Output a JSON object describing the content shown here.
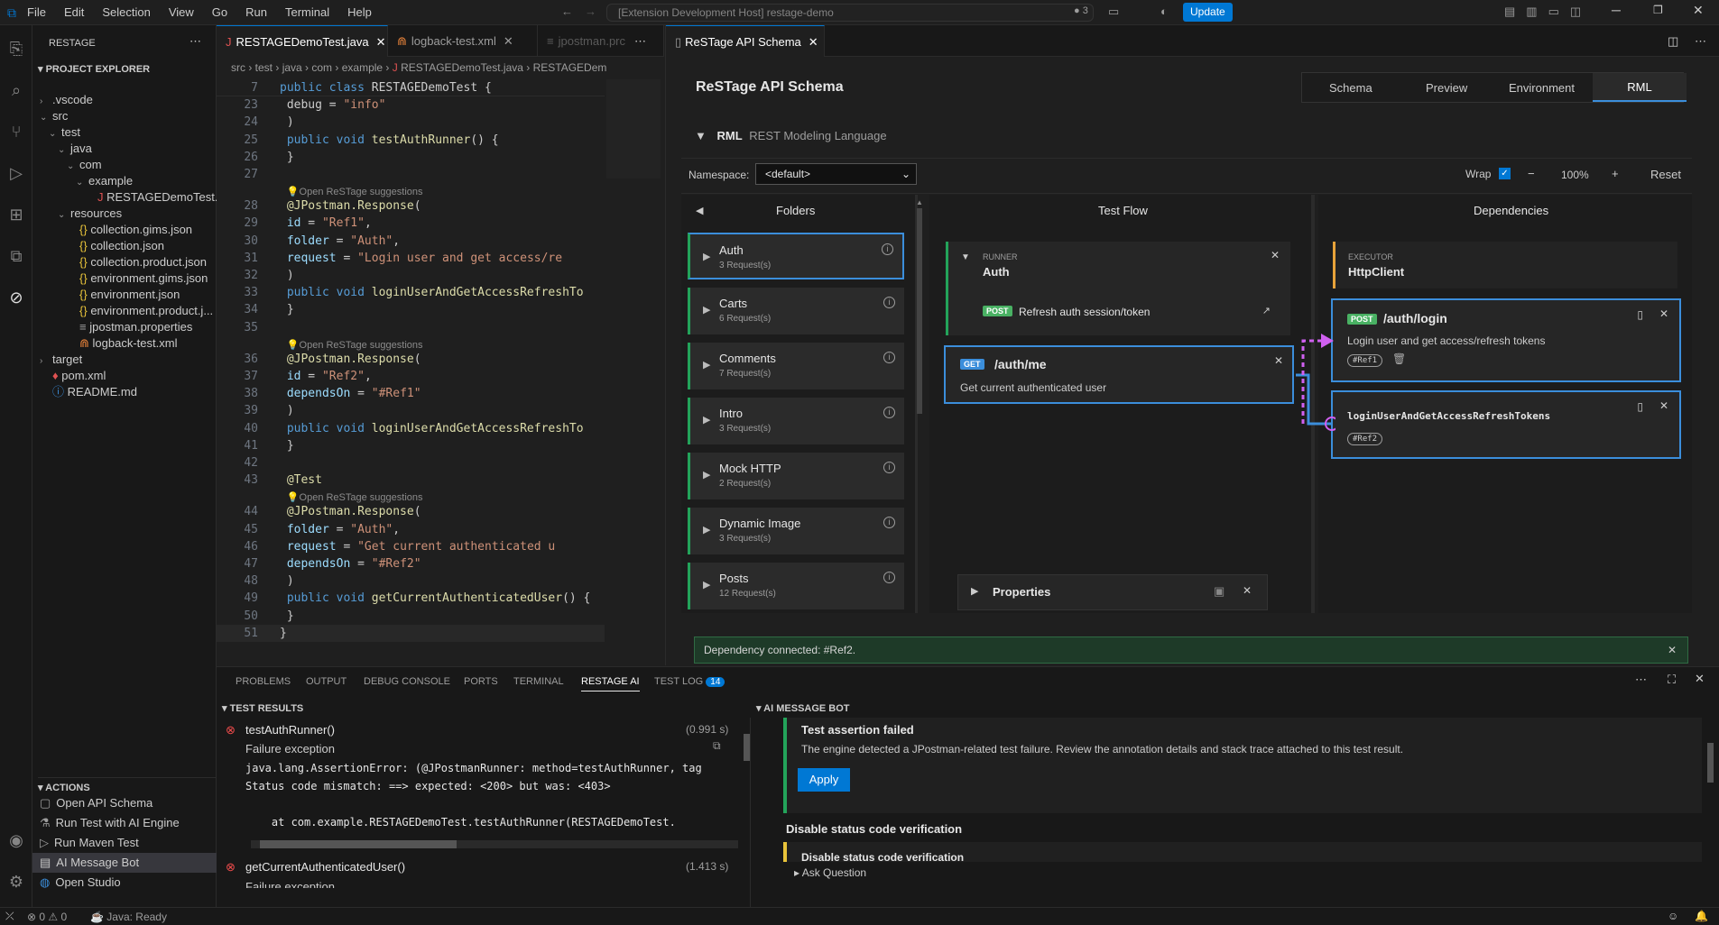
{
  "titlebar": {
    "menus": [
      "File",
      "Edit",
      "Selection",
      "View",
      "Go",
      "Run",
      "Terminal",
      "Help"
    ],
    "command_center": "[Extension Development Host] restage-demo",
    "notif_count": "3",
    "update_label": "Update"
  },
  "sidebar": {
    "title": "RESTAGE",
    "section": "PROJECT EXPLORER",
    "tree": [
      {
        "label": ".vscode",
        "depth": 0,
        "type": "folder",
        "open": false
      },
      {
        "label": "src",
        "depth": 0,
        "type": "folder",
        "open": true
      },
      {
        "label": "test",
        "depth": 1,
        "type": "folder",
        "open": true
      },
      {
        "label": "java",
        "depth": 2,
        "type": "folder",
        "open": true
      },
      {
        "label": "com",
        "depth": 3,
        "type": "folder",
        "open": true
      },
      {
        "label": "example",
        "depth": 4,
        "type": "folder",
        "open": true
      },
      {
        "label": "RESTAGEDemoTest....",
        "depth": 5,
        "type": "java"
      },
      {
        "label": "resources",
        "depth": 2,
        "type": "folder",
        "open": true
      },
      {
        "label": "collection.gims.json",
        "depth": 3,
        "type": "json"
      },
      {
        "label": "collection.json",
        "depth": 3,
        "type": "json"
      },
      {
        "label": "collection.product.json",
        "depth": 3,
        "type": "json"
      },
      {
        "label": "environment.gims.json",
        "depth": 3,
        "type": "json"
      },
      {
        "label": "environment.json",
        "depth": 3,
        "type": "json"
      },
      {
        "label": "environment.product.j...",
        "depth": 3,
        "type": "json"
      },
      {
        "label": "jpostman.properties",
        "depth": 3,
        "type": "props"
      },
      {
        "label": "logback-test.xml",
        "depth": 3,
        "type": "xml"
      },
      {
        "label": "target",
        "depth": 0,
        "type": "folder",
        "open": false
      },
      {
        "label": "pom.xml",
        "depth": 0,
        "type": "pom"
      },
      {
        "label": "README.md",
        "depth": 0,
        "type": "md"
      }
    ],
    "actions_title": "ACTIONS",
    "actions": [
      "Open API Schema",
      "Run Test with AI Engine",
      "Run Maven Test",
      "AI Message Bot",
      "Open Studio"
    ]
  },
  "editor": {
    "tabs": [
      "RESTAGEDemoTest.java",
      "logback-test.xml",
      "jpostman.prc"
    ],
    "breadcrumb": [
      "src",
      "test",
      "java",
      "com",
      "example",
      "RESTAGEDemoTest.java",
      "RESTAGEDem"
    ],
    "sticky": {
      "num": "7",
      "text": "public class RESTAGEDemoTest {"
    },
    "hint": "Open ReSTage suggestions"
  },
  "schema": {
    "tab_label": "ReSTage API Schema",
    "title": "ReSTage API Schema",
    "tabs": [
      "Schema",
      "Preview",
      "Environment",
      "RML"
    ],
    "rml_label": "RML",
    "rml_sub": "REST Modeling Language",
    "namespace_label": "Namespace:",
    "namespace_value": "<default>",
    "wrap_label": "Wrap",
    "zoom": "100%",
    "reset": "Reset",
    "minus": "−",
    "plus": "+",
    "folders_title": "Folders",
    "flow_title": "Test Flow",
    "deps_title": "Dependencies",
    "folders": [
      {
        "name": "Auth",
        "count": "3 Request(s)"
      },
      {
        "name": "Carts",
        "count": "6 Request(s)"
      },
      {
        "name": "Comments",
        "count": "7 Request(s)"
      },
      {
        "name": "Intro",
        "count": "3 Request(s)"
      },
      {
        "name": "Mock HTTP",
        "count": "2 Request(s)"
      },
      {
        "name": "Dynamic Image",
        "count": "3 Request(s)"
      },
      {
        "name": "Posts",
        "count": "12 Request(s)"
      }
    ],
    "runner": {
      "label": "RUNNER",
      "name": "Auth",
      "method": "POST",
      "desc": "Refresh auth session/token"
    },
    "flow_item": {
      "method": "GET",
      "path": "/auth/me",
      "desc": "Get current authenticated user"
    },
    "executor": {
      "label": "EXECUTOR",
      "name": "HttpClient"
    },
    "dep1": {
      "method": "POST",
      "path": "/auth/login",
      "desc": "Login user and get access/refresh tokens",
      "ref": "#Ref1"
    },
    "dep2": {
      "name": "loginUserAndGetAccessRefreshTokens",
      "ref": "#Ref2"
    },
    "properties": "Properties",
    "toast": "Dependency connected: #Ref2."
  },
  "panel": {
    "tabs": [
      "PROBLEMS",
      "OUTPUT",
      "DEBUG CONSOLE",
      "PORTS",
      "TERMINAL",
      "RESTAGE AI",
      "TEST LOG"
    ],
    "testlog_count": "14",
    "results_title": "TEST RESULTS",
    "results": [
      {
        "name": "testAuthRunner()",
        "time": "(0.991 s)",
        "sub": "Failure exception"
      },
      {
        "name": "getCurrentAuthenticatedUser()",
        "time": "(1.413 s)",
        "sub": "Failure exception"
      }
    ],
    "trace": [
      "java.lang.AssertionError: (@JPostmanRunner: method=testAuthRunner, tag",
      "Status code mismatch: ==> expected: <200> but was: <403>",
      "",
      "    at com.example.RESTAGEDemoTest.testAuthRunner(RESTAGEDemoTest."
    ],
    "bot_title": "AI MESSAGE BOT",
    "bot_card_title": "Test assertion failed",
    "bot_card_text": "The engine detected a JPostman-related test failure. Review the annotation details and stack trace attached to this test result.",
    "apply": "Apply",
    "suggestion_title": "Disable status code verification",
    "suggestion_sub": "Disable status code verification",
    "ask": "Ask Question"
  },
  "status": {
    "errors": "0",
    "warnings": "0",
    "java": "Java: Ready"
  }
}
